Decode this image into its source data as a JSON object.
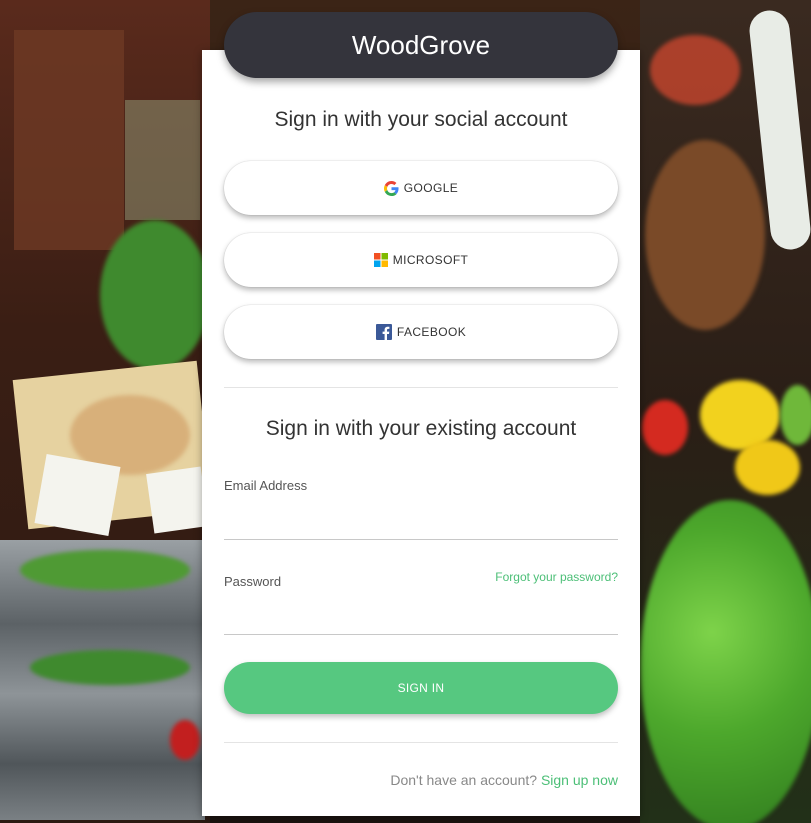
{
  "brand": {
    "title": "WoodGrove"
  },
  "social": {
    "heading": "Sign in with your social account",
    "providers": [
      {
        "label": "GOOGLE",
        "icon": "google-icon"
      },
      {
        "label": "MICROSOFT",
        "icon": "microsoft-icon"
      },
      {
        "label": "FACEBOOK",
        "icon": "facebook-icon"
      }
    ]
  },
  "local": {
    "heading": "Sign in with your existing account",
    "email_label": "Email Address",
    "email_value": "",
    "password_label": "Password",
    "password_value": "",
    "forgot_link": "Forgot your password?",
    "signin_label": "SIGN IN",
    "signup_prompt": "Don't have an account?",
    "signup_link": "Sign up now"
  },
  "colors": {
    "brand_bar": "#34343c",
    "accent_green": "#56c880",
    "link_green": "#4cbf77",
    "facebook_blue": "#3b5998"
  }
}
